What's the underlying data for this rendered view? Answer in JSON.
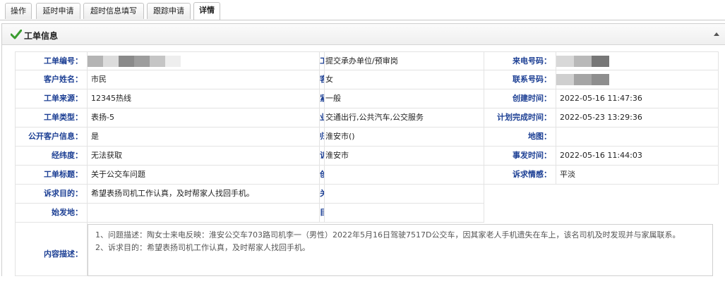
{
  "tabs": [
    "操作",
    "延时申请",
    "超时信息填写",
    "跟踪申请",
    "详情"
  ],
  "panel": {
    "title": "工单信息"
  },
  "rows": [
    [
      {
        "label": "工单编号：",
        "value": "",
        "redacted": true
      },
      {
        "label": "工单状态：",
        "value": "提交承办单位/预审岗"
      },
      {
        "label": "来电号码：",
        "value": "",
        "redacted": true
      }
    ],
    [
      {
        "label": "客户姓名：",
        "value": "市民"
      },
      {
        "label": "客户性别：",
        "value": "女"
      },
      {
        "label": "联系号码：",
        "value": "",
        "redacted": true
      }
    ],
    [
      {
        "label": "工单来源：",
        "value": "12345热线"
      },
      {
        "label": "紧急程度：",
        "value": "一般"
      },
      {
        "label": "创建时间：",
        "value": "2022-05-16 11:47:36"
      }
    ],
    [
      {
        "label": "工单类型：",
        "value": "表扬-5"
      },
      {
        "label": "业务类型：",
        "value": "交通出行,公共汽车,公交服务"
      },
      {
        "label": "计划完成时间：",
        "value": "2022-05-23 13:29:36"
      }
    ],
    [
      {
        "label": "公开客户信息：",
        "value": "是"
      },
      {
        "label": "归属地：",
        "value": "淮安市()"
      },
      {
        "label": "地图：",
        "value": ""
      }
    ],
    [
      {
        "label": "经纬度：",
        "value": "无法获取"
      },
      {
        "label": "诉求地址：",
        "value": "淮安市"
      },
      {
        "label": "事发时间：",
        "value": "2022-05-16 11:44:03"
      }
    ],
    [
      {
        "label": "工单标题：",
        "value": "关于公交车问题"
      },
      {
        "label": "创建者工号：",
        "value": ""
      },
      {
        "label": "诉求情感：",
        "value": "平淡"
      }
    ],
    [
      {
        "label": "诉求目的：",
        "value": "希望表扬司机工作认真，及时帮家人找回手机。"
      },
      {
        "label": "关联工单：",
        "value": ""
      }
    ],
    [
      {
        "label": "始发地：",
        "value": ""
      },
      {
        "label": "目的地：",
        "value": ""
      }
    ]
  ],
  "description": {
    "label": "内容描述：",
    "lines": [
      "1、问题描述：陶女士来电反映：淮安公交车703路司机李一（男性）2022年5月16日驾驶7517D公交车，因其家老人手机遗失在车上，该名司机及时发现并与家属联系。",
      "2、诉求目的：希望表扬司机工作认真，及时帮家人找回手机。"
    ]
  }
}
